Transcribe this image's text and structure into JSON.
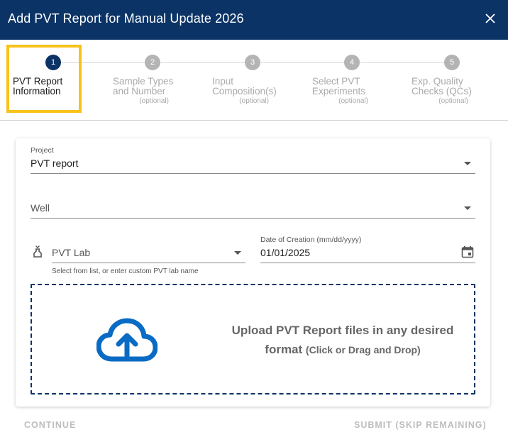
{
  "dialog": {
    "title": "Add PVT Report for Manual Update 2026"
  },
  "stepper": {
    "steps": [
      {
        "number": "1",
        "line1": "PVT Report",
        "line2": "Information",
        "optional": ""
      },
      {
        "number": "2",
        "line1": "Sample Types",
        "line2": "and Number",
        "optional": "(optional)"
      },
      {
        "number": "3",
        "line1": "Input",
        "line2": "Composition(s)",
        "optional": "(optional)"
      },
      {
        "number": "4",
        "line1": "Select PVT",
        "line2": "Experiments",
        "optional": "(optional)"
      },
      {
        "number": "5",
        "line1": "Exp. Quality",
        "line2": "Checks (QCs)",
        "optional": "(optional)"
      }
    ]
  },
  "form": {
    "project": {
      "label": "Project",
      "value": "PVT report"
    },
    "well": {
      "placeholder": "Well"
    },
    "pvt_lab": {
      "placeholder": "PVT Lab",
      "helper": "Select from list, or enter custom PVT lab name"
    },
    "date": {
      "label": "Date of Creation (mm/dd/yyyy)",
      "value": "01/01/2025"
    }
  },
  "upload": {
    "line1": "Upload PVT Report files in any desired",
    "line2_main": "format",
    "line2_hint": "(Click or Drag and Drop)"
  },
  "footer": {
    "continue_label": "CONTINUE",
    "submit_label": "SUBMIT (SKIP REMAINING)"
  },
  "colors": {
    "header_bg": "#0b3366",
    "highlight": "#f7c21a",
    "upload_icon": "#0a6bc4"
  }
}
